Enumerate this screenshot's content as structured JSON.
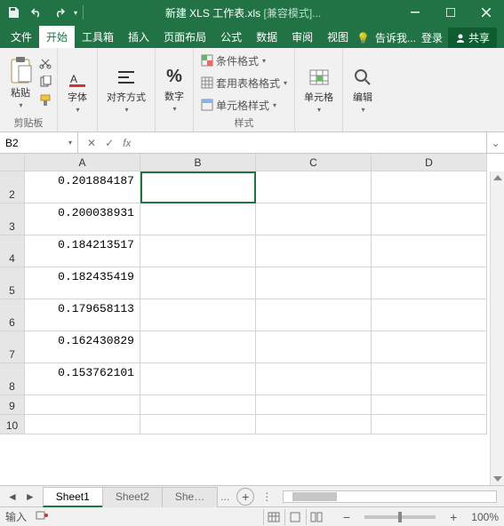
{
  "title": {
    "filename": "新建 XLS 工作表.xls",
    "mode": "[兼容模式]"
  },
  "tabs": {
    "items": [
      "文件",
      "开始",
      "工具箱",
      "插入",
      "页面布局",
      "公式",
      "数据",
      "审阅",
      "视图"
    ],
    "active_index": 1
  },
  "tellme": "告诉我...",
  "signin": "登录",
  "share": "共享",
  "ribbon": {
    "clipboard": {
      "paste": "粘贴",
      "group": "剪贴板"
    },
    "font": {
      "btn": "字体"
    },
    "align": {
      "btn": "对齐方式"
    },
    "number": {
      "btn": "数字"
    },
    "styles": {
      "cond": "条件格式",
      "tbl": "套用表格格式",
      "cell": "单元格样式",
      "group": "样式"
    },
    "cells": {
      "btn": "单元格"
    },
    "editing": {
      "btn": "编辑"
    }
  },
  "namebox": "B2",
  "columns": [
    "A",
    "B",
    "C",
    "D"
  ],
  "rows": [
    {
      "n": 2,
      "a": "0.201884187"
    },
    {
      "n": 3,
      "a": "0.200038931"
    },
    {
      "n": 4,
      "a": "0.184213517"
    },
    {
      "n": 5,
      "a": "0.182435419"
    },
    {
      "n": 6,
      "a": "0.179658113"
    },
    {
      "n": 7,
      "a": "0.162430829"
    },
    {
      "n": 8,
      "a": "0.153762101"
    },
    {
      "n": 9,
      "a": ""
    },
    {
      "n": 10,
      "a": ""
    }
  ],
  "sheets": {
    "items": [
      "Sheet1",
      "Sheet2",
      "She…"
    ],
    "active_index": 0,
    "more": "..."
  },
  "status": {
    "mode": "输入",
    "zoom": "100%"
  }
}
